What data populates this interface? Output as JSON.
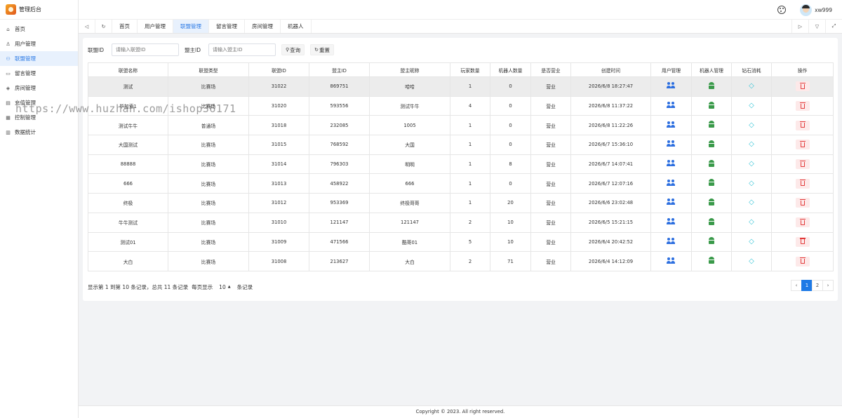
{
  "app": {
    "title": "管理后台"
  },
  "sidebar": {
    "items": [
      {
        "label": "首页",
        "icon": "home-icon"
      },
      {
        "label": "用户管理",
        "icon": "user-icon"
      },
      {
        "label": "联盟管理",
        "icon": "users-icon",
        "active": true
      },
      {
        "label": "留言管理",
        "icon": "message-icon"
      },
      {
        "label": "房间管理",
        "icon": "settings-icon"
      },
      {
        "label": "充值管理",
        "icon": "calculator-icon"
      },
      {
        "label": "控制管理",
        "icon": "grid-icon"
      },
      {
        "label": "数据统计",
        "icon": "bar-chart-icon"
      }
    ]
  },
  "header": {
    "username": "xw999"
  },
  "tabs": [
    "首页",
    "用户管理",
    "联盟管理",
    "留言管理",
    "房间管理",
    "机器人"
  ],
  "search": {
    "alliance_id_label": "联盟ID",
    "alliance_id_placeholder": "请输入联盟ID",
    "owner_id_label": "盟主ID",
    "owner_id_placeholder": "请输入盟主ID",
    "query_label": "查询",
    "reset_label": "重置"
  },
  "table": {
    "columns": [
      "联盟名称",
      "联盟类型",
      "联盟ID",
      "盟主ID",
      "盟主昵称",
      "玩家数量",
      "机器人数量",
      "是否营业",
      "创建时间",
      "用户管理",
      "机器人管理",
      "钻石消耗",
      "操作"
    ],
    "rows": [
      [
        "测试",
        "比赛场",
        "31022",
        "869751",
        "哈哈",
        "1",
        "0",
        "营业",
        "2026/6/8 18:27:47"
      ],
      [
        "毕加索1",
        "比赛场",
        "31020",
        "593556",
        "测试牛牛",
        "4",
        "0",
        "营业",
        "2026/6/8 11:37:22"
      ],
      [
        "测试牛牛",
        "普通场",
        "31018",
        "232085",
        "1005",
        "1",
        "0",
        "营业",
        "2026/6/8 11:22:26"
      ],
      [
        "大国测试",
        "比赛场",
        "31015",
        "768592",
        "大国",
        "1",
        "0",
        "营业",
        "2026/6/7 15:36:10"
      ],
      [
        "88888",
        "比赛场",
        "31014",
        "796303",
        "明明",
        "1",
        "8",
        "营业",
        "2026/6/7 14:07:41"
      ],
      [
        "666",
        "比赛场",
        "31013",
        "458922",
        "666",
        "1",
        "0",
        "营业",
        "2026/6/7 12:07:16"
      ],
      [
        "终极",
        "比赛场",
        "31012",
        "953369",
        "终极哥哥",
        "1",
        "20",
        "营业",
        "2026/6/6 23:02:48"
      ],
      [
        "牛牛测试",
        "比赛场",
        "31010",
        "121147",
        "121147",
        "2",
        "10",
        "营业",
        "2026/6/5 15:21:15"
      ],
      [
        "测试01",
        "比赛场",
        "31009",
        "471566",
        "酷哥01",
        "5",
        "10",
        "营业",
        "2026/6/4 20:42:52"
      ],
      [
        "大白",
        "比赛场",
        "31008",
        "213627",
        "大白",
        "2",
        "71",
        "营业",
        "2026/6/4 14:12:09"
      ]
    ]
  },
  "pagination": {
    "summary": "显示第 1 到第 10 条记录，总共 11 条记录",
    "per_page_label": "每页显示",
    "page_size": "10",
    "records_label": "条记录",
    "pages": [
      "1",
      "2"
    ],
    "prev": "‹",
    "next": "›"
  },
  "footer": {
    "copyright": "Copyright © 2023. All right reserved."
  },
  "watermark": "https://www.huzhan.com/ishop36171"
}
